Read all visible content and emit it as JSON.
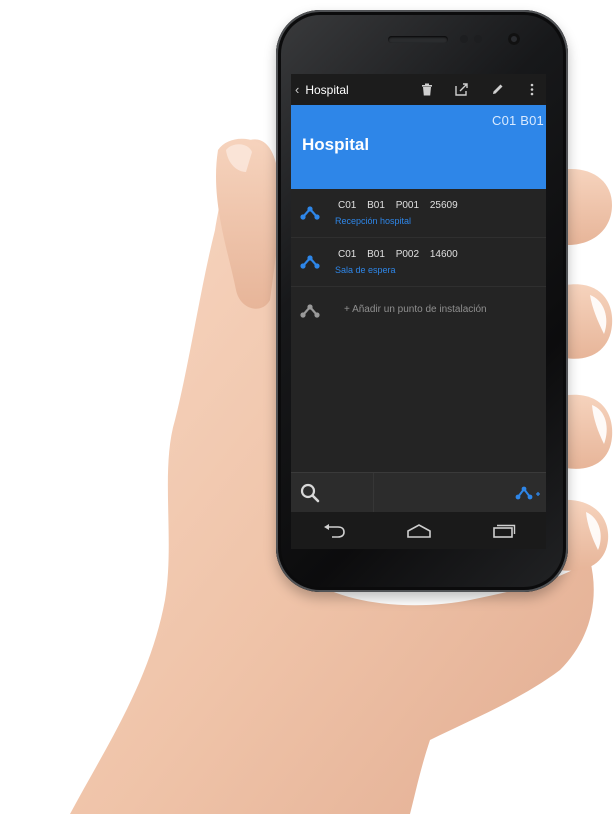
{
  "colors": {
    "accent": "#2e86e8",
    "screen_bg": "#242424",
    "actionbar_bg": "#1c1c1c"
  },
  "actionbar": {
    "back_icon": "chevron-left-icon",
    "title": "Hospital",
    "actions": [
      "trash-icon",
      "share-icon",
      "edit-icon",
      "overflow-menu-icon"
    ]
  },
  "header": {
    "code": "C01 B01",
    "title": "Hospital"
  },
  "list": {
    "items": [
      {
        "codes": "C01 B01 P001 25609",
        "subtitle": "Recepción hospital",
        "icon": "installation-point-icon"
      },
      {
        "codes": "C01 B01 P002 14600",
        "subtitle": "Sala de espera",
        "icon": "installation-point-icon"
      }
    ],
    "add_label": "+ Añadir un punto de instalación"
  },
  "bottombar": {
    "left_icon": "search-icon",
    "right_icon": "add-installation-point-icon"
  },
  "navbar": {
    "buttons": [
      "back-icon",
      "home-icon",
      "recent-apps-icon"
    ]
  }
}
